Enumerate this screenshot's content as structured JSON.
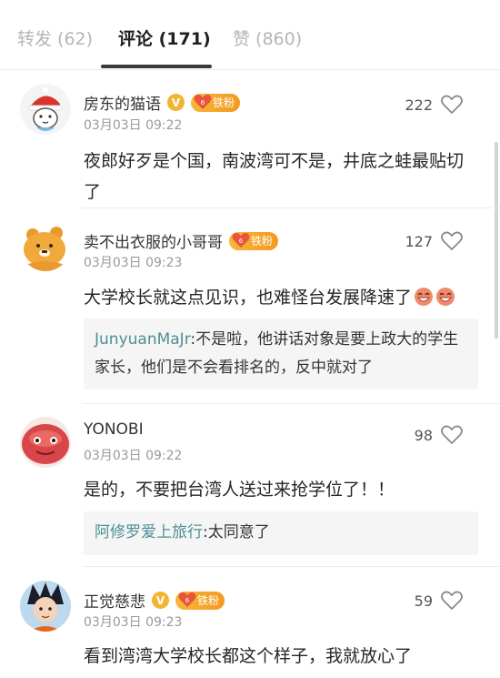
{
  "tabs": [
    {
      "label": "转发 (62)",
      "active": false
    },
    {
      "label": "评论 (171)",
      "active": true
    },
    {
      "label": "赞 (860)",
      "active": false
    }
  ],
  "fan_badge_label": "铁粉",
  "colors": {
    "badge": "#f3a72a",
    "reply_author": "#4d8f95",
    "verified": "#f2b533"
  },
  "comments": [
    {
      "username": "房东的猫语",
      "verified": true,
      "avatar_icon": "cartoon-cat-with-hat-avatar",
      "timestamp": "03月03日 09:22",
      "likes": "222",
      "content": "夜郎好歹是个国，南波湾可不是，井底之蛙最贴切了"
    },
    {
      "username": "卖不出衣服的小哥哥",
      "verified": false,
      "avatar_icon": "orange-bear-avatar",
      "timestamp": "03月03日 09:23",
      "likes": "127",
      "content": "大学校长就这点见识，也难怪台发展降速了",
      "emojis": [
        "laughing-face-emoji",
        "laughing-face-emoji"
      ],
      "reply": {
        "author": "JunyuanMaJr",
        "text": ":不是啦，他讲话对象是要上政大的学生家长，他们是不会看排名的，反中就对了"
      }
    },
    {
      "username": "YONOBI",
      "verified": false,
      "avatar_icon": "red-creature-avatar",
      "timestamp": "03月03日 09:22",
      "likes": "98",
      "content": "是的，不要把台湾人送过来抢学位了！！",
      "reply": {
        "author": "阿修罗爱上旅行",
        "text": ":太同意了"
      }
    },
    {
      "username": "正觉慈悲",
      "verified": true,
      "avatar_icon": "anime-character-avatar",
      "timestamp": "03月03日 09:23",
      "likes": "59",
      "content": "看到湾湾大学校长都这个样子，我就放心了"
    }
  ]
}
